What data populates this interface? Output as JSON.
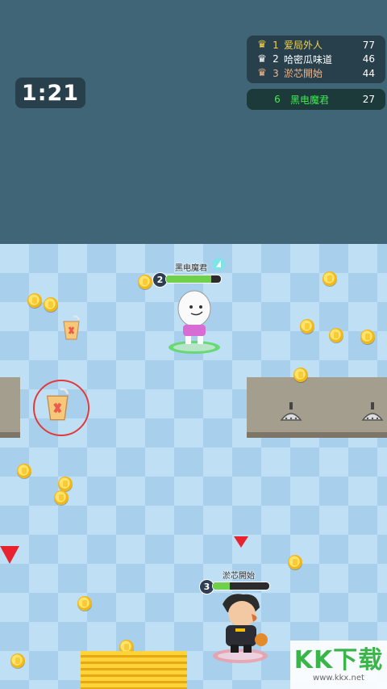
{
  "hud": {
    "timer": "1:21",
    "leaderboard": [
      {
        "rank": "1",
        "name": "爱局外人",
        "score": "77",
        "crown": "gold-crown-icon",
        "color": "#f2d34a"
      },
      {
        "rank": "2",
        "name": "哈密瓜味道",
        "score": "46",
        "crown": "silver-crown-icon",
        "color": "#ffffff"
      },
      {
        "rank": "3",
        "name": "淤芯開始",
        "score": "44",
        "crown": "bronze-crown-icon",
        "color": "#f0b68a"
      }
    ],
    "self": {
      "rank": "6",
      "name": "黑电魔君",
      "score": "27",
      "color": "#3bee4c"
    }
  },
  "players": {
    "hero": {
      "name": "黑电魔君",
      "level": "2",
      "health": 0.82
    },
    "rival": {
      "name": "淤芯開始",
      "level": "3",
      "health": 0.3
    }
  },
  "watermark": {
    "brand": "KK下载",
    "url": "www.kkx.net"
  },
  "colors": {
    "sky": "#3f6577",
    "hud_bg": "#283f4c",
    "coin": "#f1b81a",
    "marker": "#e8232f"
  }
}
